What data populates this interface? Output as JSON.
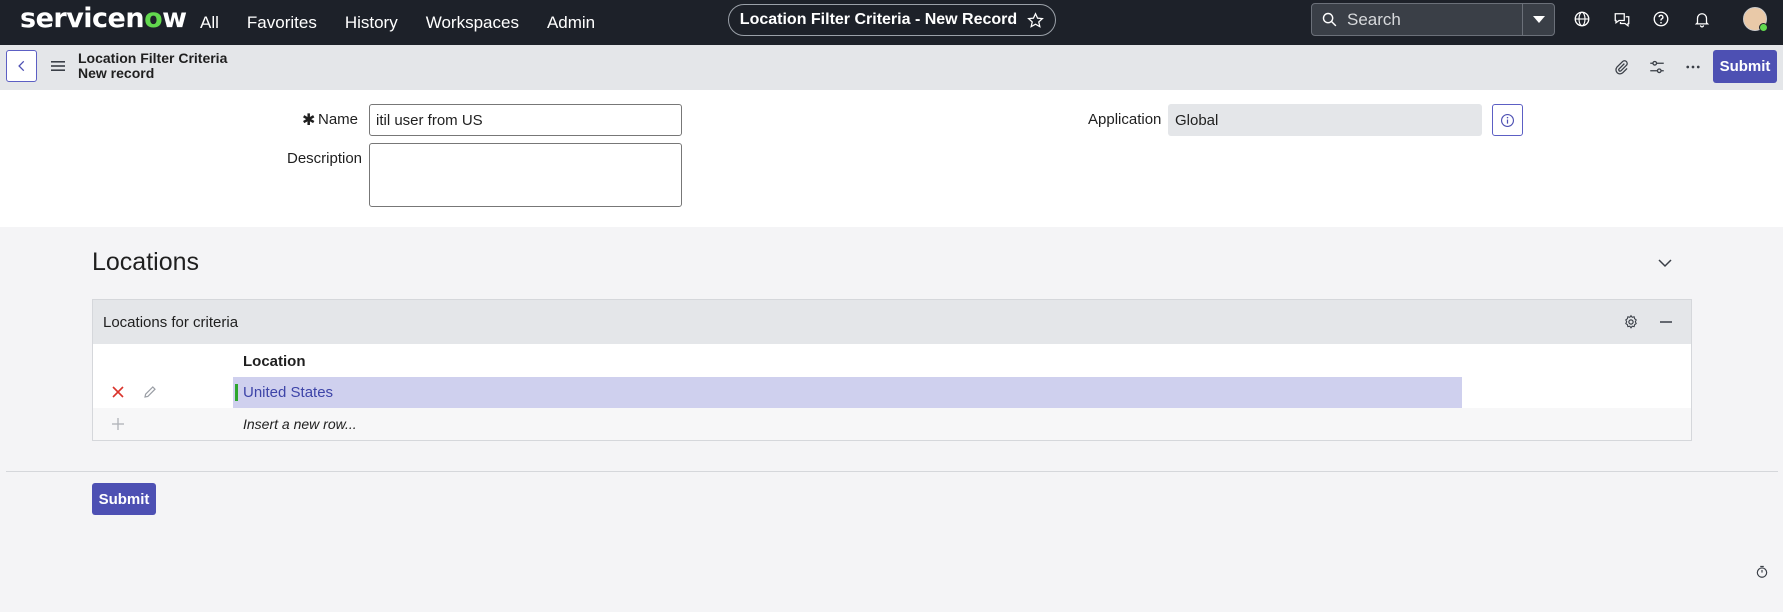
{
  "nav": {
    "logo": "servicenow",
    "menu": [
      "All",
      "Favorites",
      "History",
      "Workspaces",
      "Admin"
    ],
    "record_pill": "Location Filter Criteria - New Record",
    "search_placeholder": "Search"
  },
  "subheader": {
    "title": "Location Filter Criteria",
    "subtitle": "New record",
    "submit_label": "Submit"
  },
  "form": {
    "name_label": "Name",
    "name_value": "itil user from US",
    "description_label": "Description",
    "description_value": "",
    "application_label": "Application",
    "application_value": "Global"
  },
  "related": {
    "section_title": "Locations",
    "list_title": "Locations for criteria",
    "column_header": "Location",
    "rows": [
      "United States"
    ],
    "insert_row_label": "Insert a new row..."
  },
  "footer": {
    "submit_label": "Submit"
  },
  "colors": {
    "nav_bg": "#1d2129",
    "brand_green": "#62d84e",
    "primary_button": "#4d50b3",
    "selected_row": "#cfd0ee",
    "link": "#3d44a8"
  }
}
